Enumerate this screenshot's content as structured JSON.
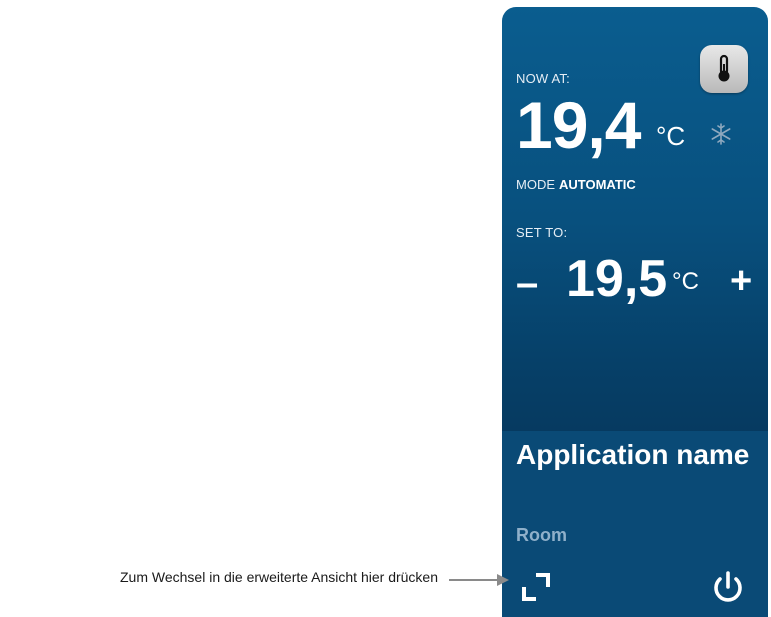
{
  "widget": {
    "now_label": "NOW AT:",
    "current_temp": "19,4",
    "unit": "°C",
    "mode_label": "MODE",
    "mode_value": "AUTOMATIC",
    "set_label": "SET TO:",
    "set_temp": "19,5",
    "minus": "–",
    "plus": "+",
    "app_name": "Application name",
    "room": "Room",
    "thermometer_icon": "thermometer-icon",
    "snow_icon": "snowflake-icon",
    "expand_icon": "expand-icon",
    "power_icon": "power-icon",
    "colors": {
      "widget_top": "#0a5d8f",
      "widget_bottom": "#042b4c",
      "footer": "#0a4a76",
      "room_text": "#8fb0ca"
    }
  },
  "annotation": {
    "text": "Zum Wechsel in die erweiterte Ansicht hier drücken"
  }
}
